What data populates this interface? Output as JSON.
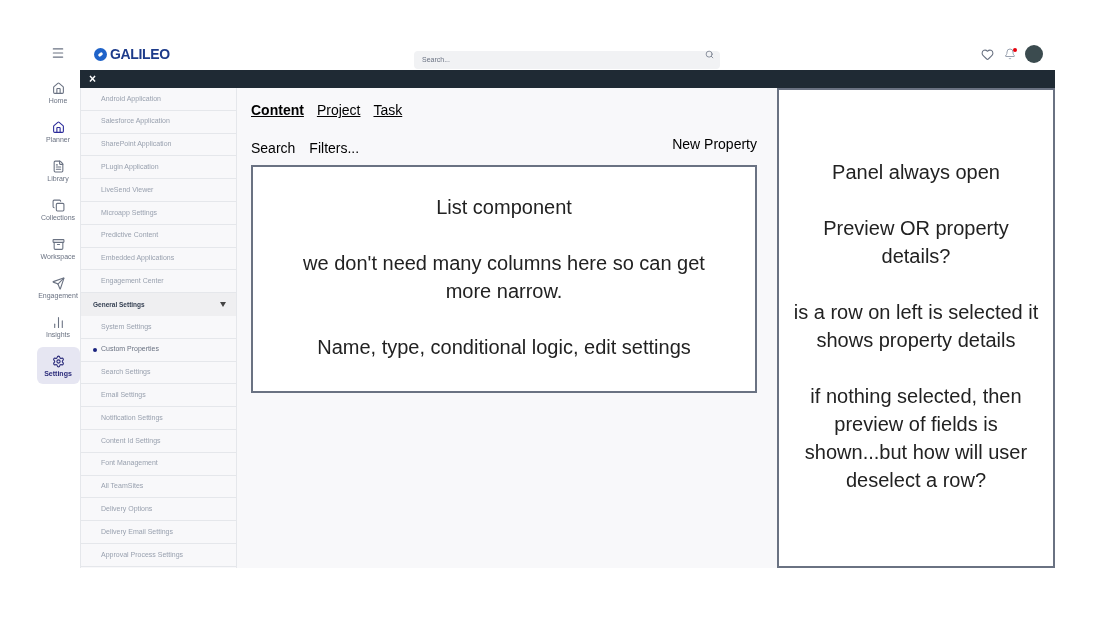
{
  "rail": {
    "items": [
      {
        "label": "Home",
        "selected": false
      },
      {
        "label": "Planner",
        "selected": false
      },
      {
        "label": "Library",
        "selected": false
      },
      {
        "label": "Collections",
        "selected": false
      },
      {
        "label": "Workspace",
        "selected": false
      },
      {
        "label": "Engagement",
        "selected": false
      },
      {
        "label": "Insights",
        "selected": false
      },
      {
        "label": "Settings",
        "selected": true
      }
    ]
  },
  "header": {
    "logo": "GALILEO",
    "search": {
      "placeholder": "Search..."
    },
    "notification_dot": true
  },
  "banner": {
    "close": "×"
  },
  "settings_menu": {
    "items": [
      {
        "kind": "item",
        "label": "Android Application",
        "selected": false
      },
      {
        "kind": "item",
        "label": "Salesforce Application",
        "selected": false
      },
      {
        "kind": "item",
        "label": "SharePoint Application",
        "selected": false
      },
      {
        "kind": "item",
        "label": "PLugin Application",
        "selected": false
      },
      {
        "kind": "item",
        "label": "LiveSend Viewer",
        "selected": false
      },
      {
        "kind": "item",
        "label": "Microapp Settings",
        "selected": false
      },
      {
        "kind": "item",
        "label": "Predictive Content",
        "selected": false
      },
      {
        "kind": "item",
        "label": "Embedded Applications",
        "selected": false
      },
      {
        "kind": "item",
        "label": "Engagement Center",
        "selected": false
      },
      {
        "kind": "header",
        "label": "General Settings",
        "expanded": true
      },
      {
        "kind": "item",
        "label": "System Settings",
        "selected": false
      },
      {
        "kind": "item",
        "label": "Custom Properties",
        "selected": true
      },
      {
        "kind": "item",
        "label": "Search Settings",
        "selected": false
      },
      {
        "kind": "item",
        "label": "Email Settings",
        "selected": false
      },
      {
        "kind": "item",
        "label": "Notification Settings",
        "selected": false
      },
      {
        "kind": "item",
        "label": "Content Id Settings",
        "selected": false
      },
      {
        "kind": "item",
        "label": "Font Management",
        "selected": false
      },
      {
        "kind": "item",
        "label": "All TeamSites",
        "selected": false
      },
      {
        "kind": "item",
        "label": "Delivery Options",
        "selected": false
      },
      {
        "kind": "item",
        "label": "Delivery Email Settings",
        "selected": false
      },
      {
        "kind": "item",
        "label": "Approval Process Settings",
        "selected": false
      }
    ]
  },
  "main": {
    "tabs": [
      {
        "label": "Content",
        "selected": true
      },
      {
        "label": "Project",
        "selected": false
      },
      {
        "label": "Task",
        "selected": false
      }
    ],
    "toolbar": {
      "search": "Search",
      "filters": "Filters...",
      "new_property": "New Property"
    },
    "list_notes": [
      "List component",
      "we don't need many columns here so can get more narrow.",
      "Name, type, conditional logic, edit settings"
    ]
  },
  "panel": {
    "notes": [
      "Panel always open",
      "Preview OR property details?",
      "is a row on left is selected it shows property details",
      "if nothing selected, then preview of fields is shown...but how will user deselect a row?"
    ]
  }
}
